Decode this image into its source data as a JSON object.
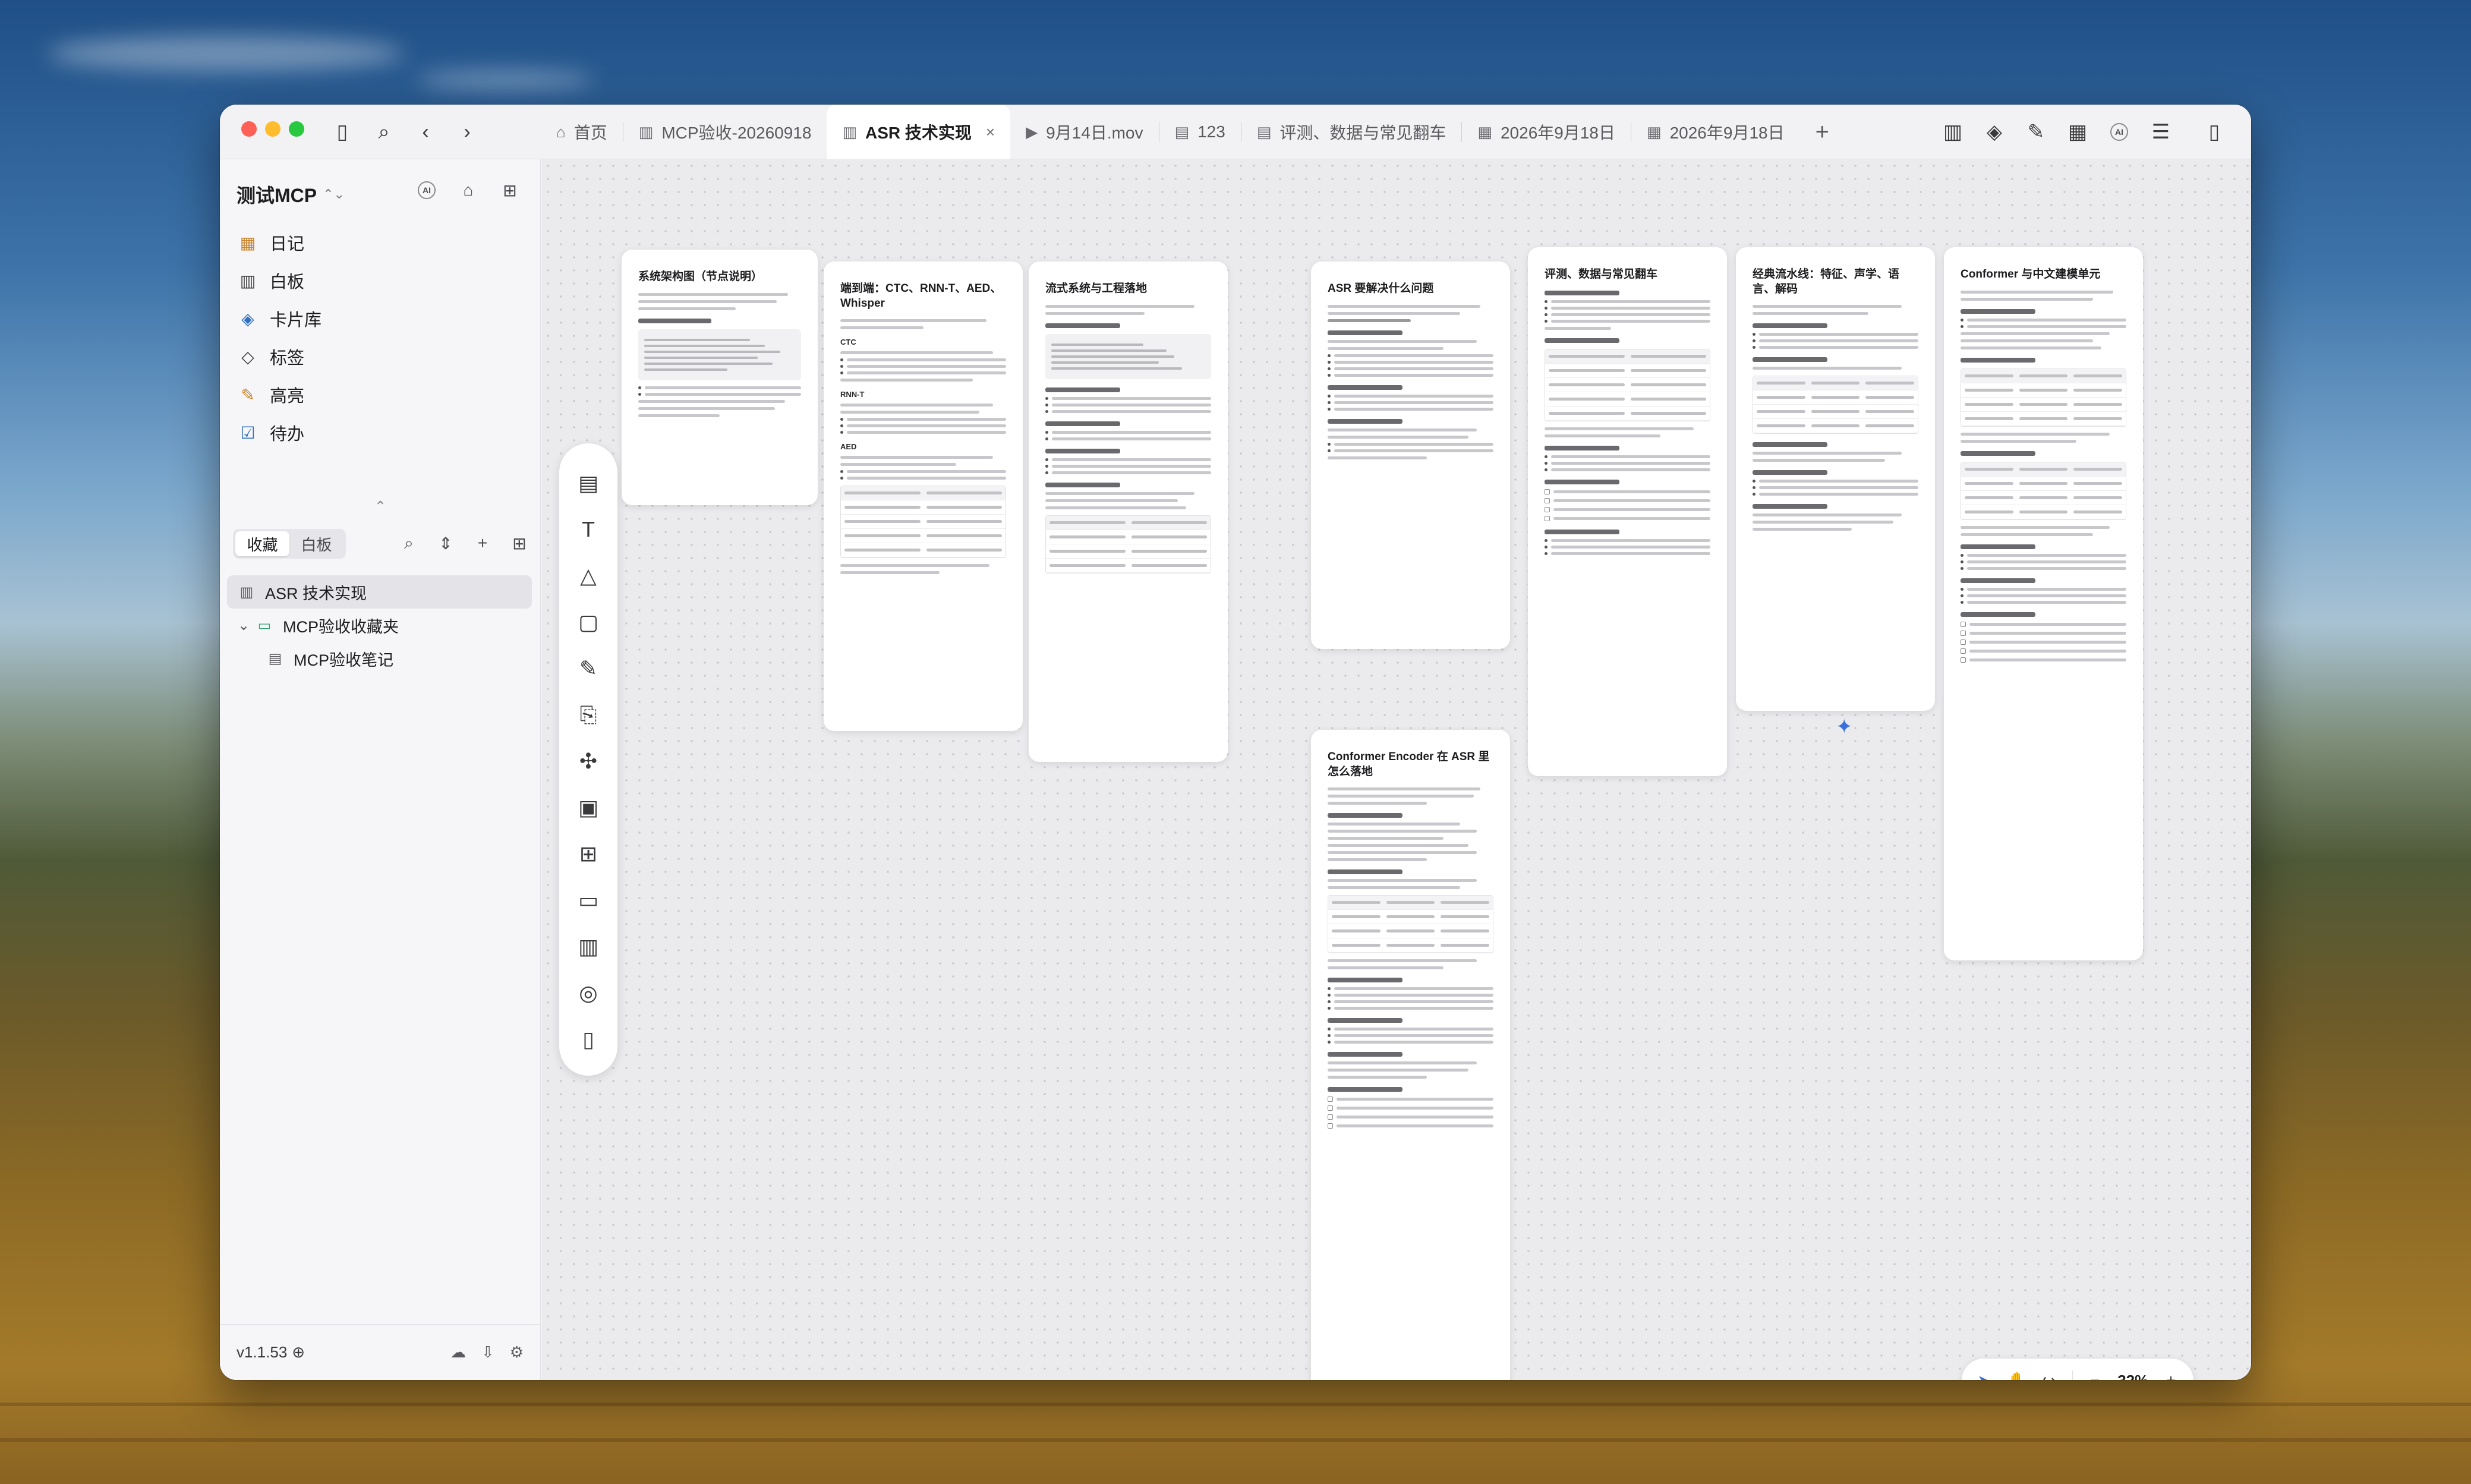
{
  "tabs": [
    {
      "icon": "home-icon",
      "glyph": "⌂",
      "label": "首页",
      "active": false
    },
    {
      "icon": "whiteboard-icon",
      "glyph": "▥",
      "label": "MCP验收-20260918",
      "active": false
    },
    {
      "icon": "whiteboard-icon",
      "glyph": "▥",
      "label": "ASR 技术实现",
      "active": true
    },
    {
      "icon": "video-icon",
      "glyph": "▶",
      "label": "9月14日.mov",
      "active": false
    },
    {
      "icon": "document-icon",
      "glyph": "▤",
      "label": "123",
      "active": false
    },
    {
      "icon": "document-icon",
      "glyph": "▤",
      "label": "评测、数据与常见翻车",
      "active": false
    },
    {
      "icon": "calendar-icon",
      "glyph": "▦",
      "label": "2026年9月18日",
      "active": false
    },
    {
      "icon": "calendar-icon",
      "glyph": "▦",
      "label": "2026年9月18日",
      "active": false
    }
  ],
  "sidebar": {
    "workspace": "测试MCP",
    "nav": [
      {
        "icon": "calendar-icon",
        "glyph": "▦",
        "label": "日记",
        "color": "#c9822b"
      },
      {
        "icon": "whiteboard-icon",
        "glyph": "▥",
        "label": "白板",
        "color": "#3d3d40"
      },
      {
        "icon": "layers-icon",
        "glyph": "◈",
        "label": "卡片库",
        "color": "#2f6fbf"
      },
      {
        "icon": "tag-icon",
        "glyph": "◇",
        "label": "标签",
        "color": "#3d3d40"
      },
      {
        "icon": "highlight-icon",
        "glyph": "✎",
        "label": "高亮",
        "color": "#c9822b"
      },
      {
        "icon": "todo-icon",
        "glyph": "☑",
        "label": "待办",
        "color": "#2f6fbf"
      }
    ],
    "segment": {
      "left": "收藏",
      "right": "白板"
    },
    "tree": [
      {
        "label": "ASR 技术实现",
        "glyph": "▥",
        "indent": 0,
        "selected": true
      },
      {
        "label": "MCP验收收藏夹",
        "glyph": "▸",
        "indent": 0,
        "selected": false,
        "folder": true
      },
      {
        "label": "MCP验收笔记",
        "glyph": "▤",
        "indent": 1,
        "selected": false
      }
    ],
    "version": "v1.1.53"
  },
  "cards": [
    {
      "title": "系统架构图（节点说明）"
    },
    {
      "title": "端到端：CTC、RNN-T、AED、Whisper"
    },
    {
      "title": "流式系统与工程落地"
    },
    {
      "title": "ASR 要解决什么问题"
    },
    {
      "title": "Conformer Encoder 在 ASR 里怎么落地"
    },
    {
      "title": "评测、数据与常见翻车"
    },
    {
      "title": "经典流水线：特征、声学、语言、解码"
    },
    {
      "title": "Conformer 与中文建模单元"
    }
  ],
  "canvas": {
    "zoom": "32%"
  }
}
